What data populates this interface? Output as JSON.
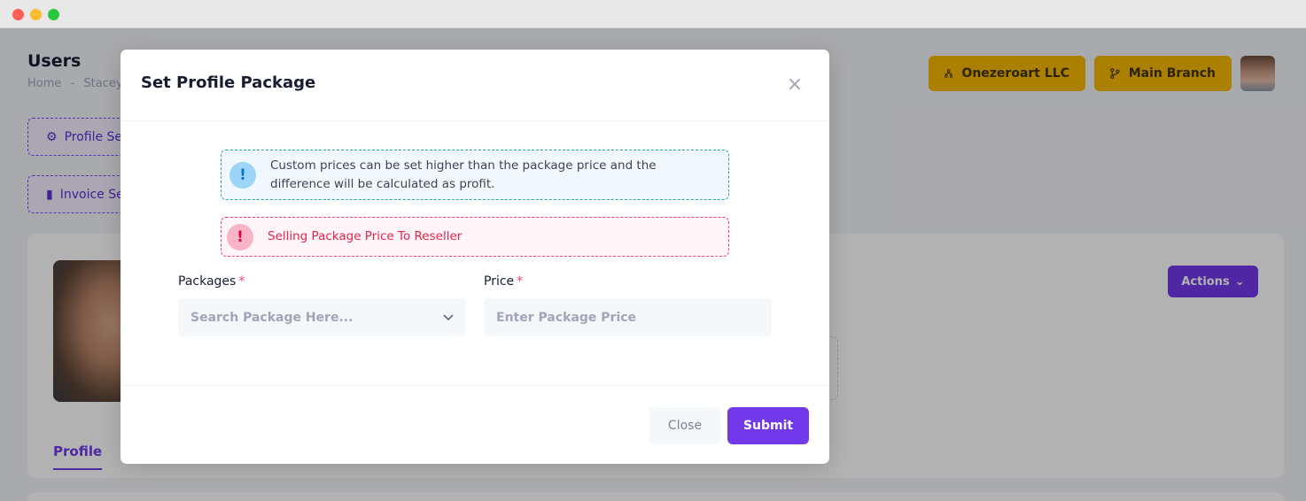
{
  "page": {
    "title": "Users",
    "breadcrumb": [
      "Home",
      "-",
      "Stacey"
    ],
    "company_label": "Onezeroart LLC",
    "branch_label": "Main Branch",
    "profile_settings_label": "Profile Se",
    "invoice_settings_label": "Invoice Se",
    "actions_label": "Actions",
    "profile_tab_label": "Profile"
  },
  "modal": {
    "title": "Set Profile Package",
    "close_icon": "×",
    "info_alert": {
      "icon": "!",
      "text": "Custom prices can be set higher than the package price and the difference will be calculated as profit."
    },
    "danger_alert": {
      "icon": "!",
      "text": "Selling Package Price To Reseller"
    },
    "packages": {
      "label": "Packages",
      "required_mark": "*",
      "placeholder": "Search Package Here..."
    },
    "price": {
      "label": "Price",
      "required_mark": "*",
      "placeholder": "Enter Package Price"
    },
    "footer": {
      "close_label": "Close",
      "submit_label": "Submit"
    }
  },
  "colors": {
    "primary": "#7239ea",
    "warning": "#f5b800",
    "info": "#2aa0b9",
    "danger": "#f1416c"
  }
}
